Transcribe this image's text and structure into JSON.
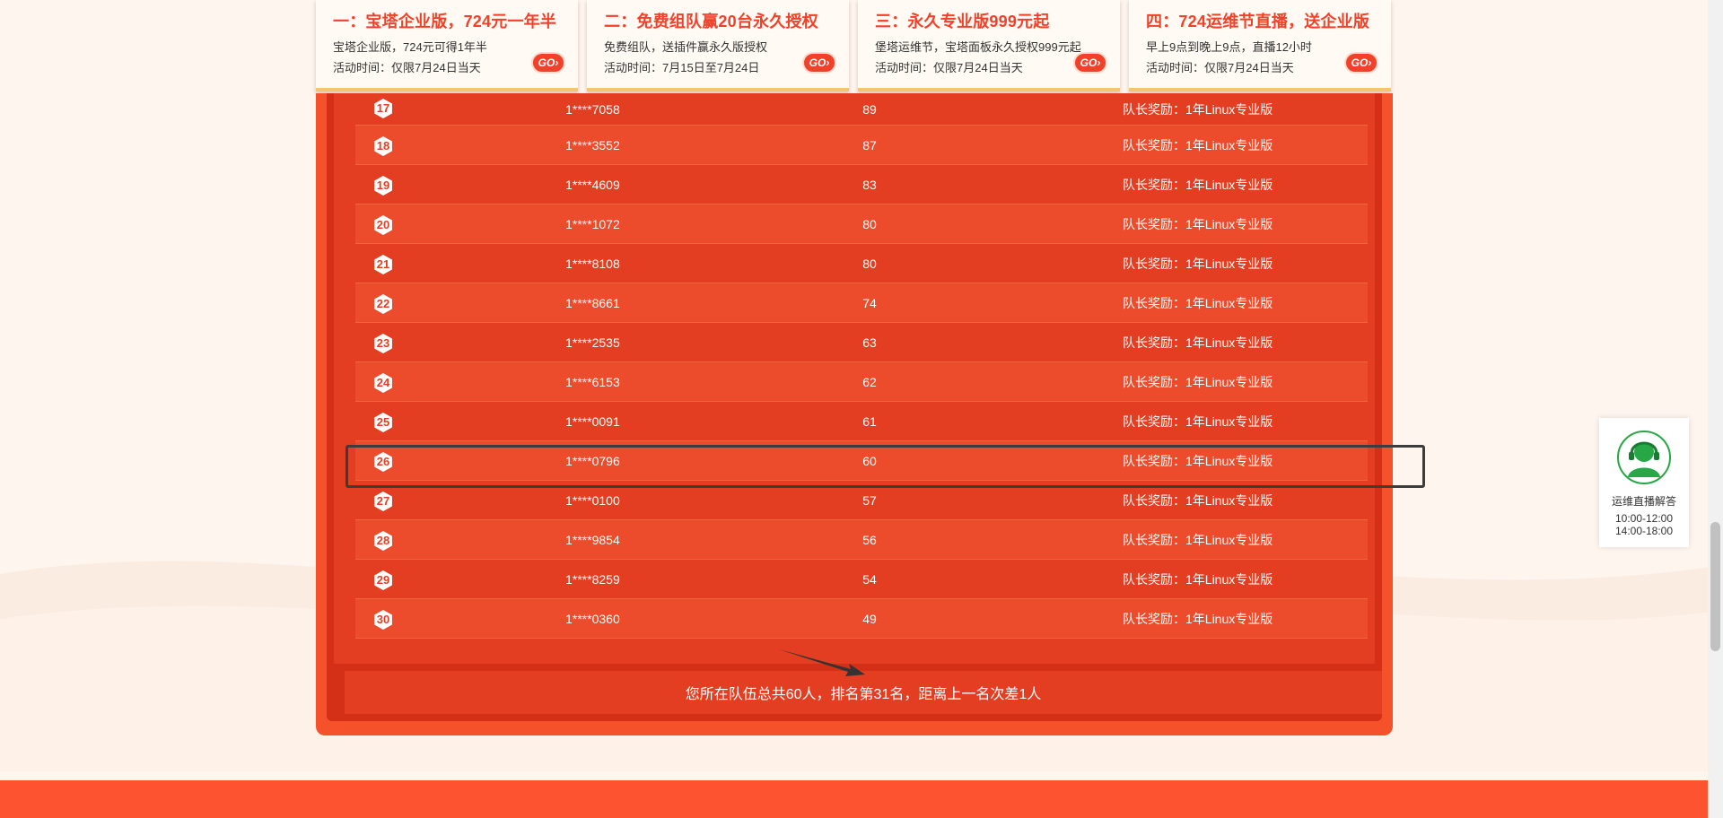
{
  "promos": [
    {
      "title": "一：宝塔企业版，724元一年半",
      "desc": "宝塔企业版，724元可得1年半",
      "time": "活动时间：仅限7月24日当天",
      "go": "GO"
    },
    {
      "title": "二：免费组队赢20台永久授权",
      "desc": "免费组队，送插件赢永久版授权",
      "time": "活动时间：7月15日至7月24日",
      "go": "GO"
    },
    {
      "title": "三：永久专业版999元起",
      "desc": "堡塔运维节，宝塔面板永久授权999元起",
      "time": "活动时间：仅限7月24日当天",
      "go": "GO"
    },
    {
      "title": "四：724运维节直播，送企业版",
      "desc": "早上9点到晚上9点，直播12小时",
      "time": "活动时间：仅限7月24日当天",
      "go": "GO"
    }
  ],
  "rows": [
    {
      "rank": "17",
      "user": "1****7058",
      "score": "89",
      "reward": "队长奖励：1年Linux专业版"
    },
    {
      "rank": "18",
      "user": "1****3552",
      "score": "87",
      "reward": "队长奖励：1年Linux专业版"
    },
    {
      "rank": "19",
      "user": "1****4609",
      "score": "83",
      "reward": "队长奖励：1年Linux专业版"
    },
    {
      "rank": "20",
      "user": "1****1072",
      "score": "80",
      "reward": "队长奖励：1年Linux专业版"
    },
    {
      "rank": "21",
      "user": "1****8108",
      "score": "80",
      "reward": "队长奖励：1年Linux专业版"
    },
    {
      "rank": "22",
      "user": "1****8661",
      "score": "74",
      "reward": "队长奖励：1年Linux专业版"
    },
    {
      "rank": "23",
      "user": "1****2535",
      "score": "63",
      "reward": "队长奖励：1年Linux专业版"
    },
    {
      "rank": "24",
      "user": "1****6153",
      "score": "62",
      "reward": "队长奖励：1年Linux专业版"
    },
    {
      "rank": "25",
      "user": "1****0091",
      "score": "61",
      "reward": "队长奖励：1年Linux专业版"
    },
    {
      "rank": "26",
      "user": "1****0796",
      "score": "60",
      "reward": "队长奖励：1年Linux专业版"
    },
    {
      "rank": "27",
      "user": "1****0100",
      "score": "57",
      "reward": "队长奖励：1年Linux专业版"
    },
    {
      "rank": "28",
      "user": "1****9854",
      "score": "56",
      "reward": "队长奖励：1年Linux专业版"
    },
    {
      "rank": "29",
      "user": "1****8259",
      "score": "54",
      "reward": "队长奖励：1年Linux专业版"
    },
    {
      "rank": "30",
      "user": "1****0360",
      "score": "49",
      "reward": "队长奖励：1年Linux专业版"
    }
  ],
  "summary": "您所在队伍总共60人，排名第31名，距离上一名次差1人",
  "support": {
    "label": "运维直播解答",
    "hours_am": "10:00-12:00",
    "hours_pm": "14:00-18:00",
    "icon": "customer-service-icon"
  },
  "colors": {
    "accent": "#f2412a",
    "panel": "#f5522c",
    "row": "#e43e22",
    "row_alt": "#ec4b2c"
  }
}
